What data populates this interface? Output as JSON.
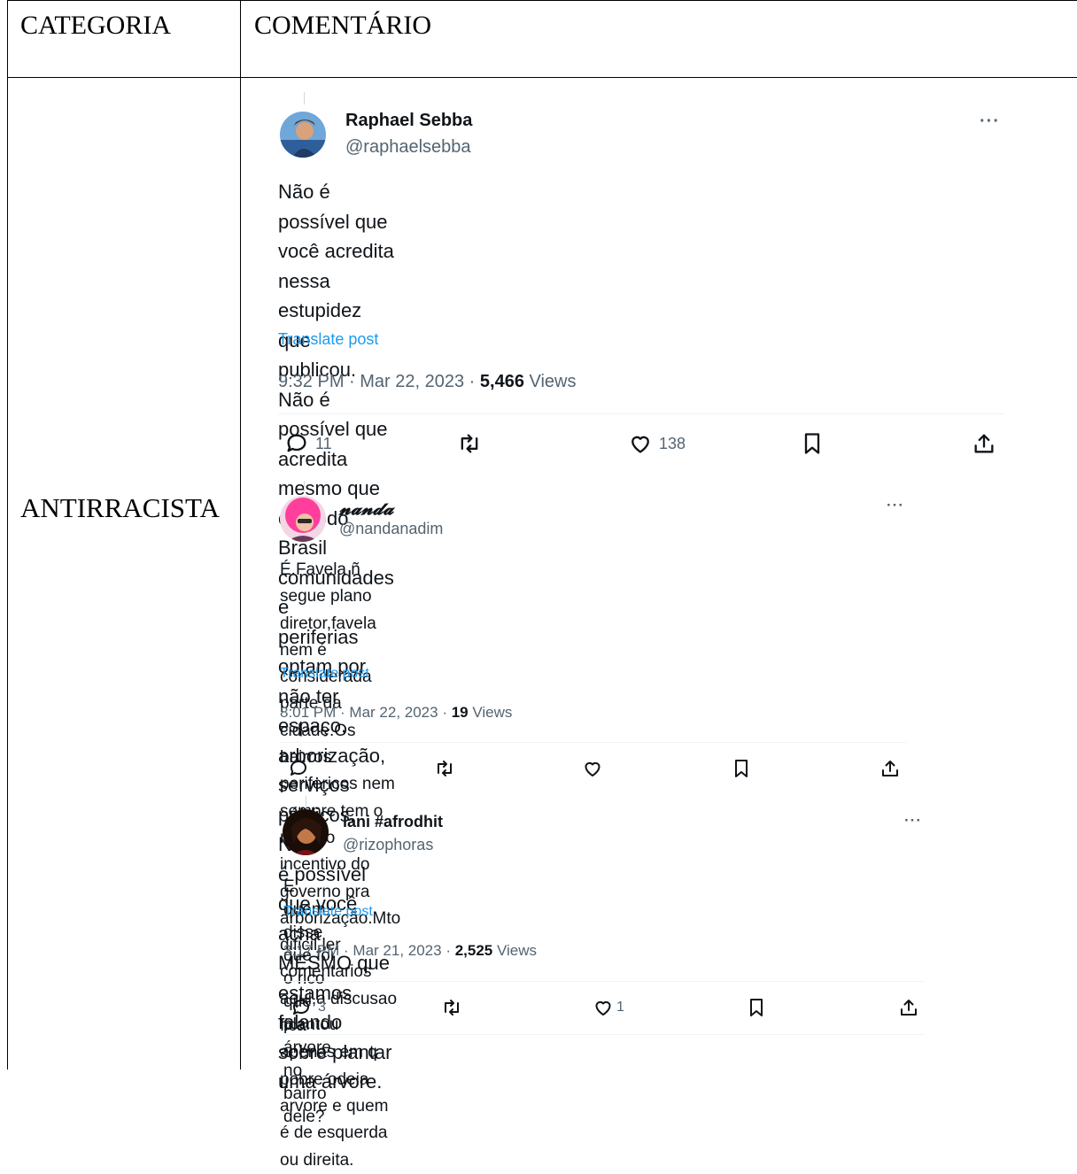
{
  "table": {
    "header_category": "CATEGORIA",
    "header_comment": "COMENTÁRIO",
    "category_value": "ANTIRRACISTA"
  },
  "tweets": [
    {
      "name": "Raphael Sebba",
      "handle": "@raphaelsebba",
      "text": "Não é possível que você acredita nessa estupidez que publicou. Não é\npossível que acredita mesmo que em todo Brasil comunidades e\nperiferias optam por não ter espaço, arborização, serviços públicos. Não\né possível que você acha MESMO que estamos falando sobre plantar\numa árvore.",
      "translate": "Translate post",
      "time": "9:32 PM · Mar 22, 2023 · ",
      "views_count": "5,466",
      "views_label": " Views",
      "replies": "11",
      "likes": "138",
      "more": "···"
    },
    {
      "name": "𝓷𝓪𝓷𝓭𝓪",
      "handle": "@nandanadim",
      "text": "É.Favela ñ segue plano diretor,favela nem é considerada parte da\ncidade.Os bairros perifericos nem sempre tem o mesmo incentivo do\ngoverno pra arborização.Mto dificil ler comentarios aqui,a discusao fica\napenas em q pobre odeia arvore e quem é de esquerda ou direita.",
      "translate": "Translate post",
      "time": "8:01 PM · Mar 22, 2023 · ",
      "views_count": "19",
      "views_label": " Views",
      "replies": "",
      "likes": "",
      "more": "···"
    },
    {
      "name": "lani #afrodhit",
      "handle": "@rizophoras",
      "text": "E quem disse que foi o rico que plantou árvore no bairro dele?",
      "translate": "Translate post",
      "time": "3:17 PM · Mar 21, 2023 · ",
      "views_count": "2,525",
      "views_label": " Views",
      "replies": "3",
      "likes": "1",
      "more": "···"
    }
  ],
  "icons": {
    "reply": "reply-icon",
    "retweet": "retweet-icon",
    "like": "heart-icon",
    "bookmark": "bookmark-icon",
    "share": "share-icon"
  }
}
